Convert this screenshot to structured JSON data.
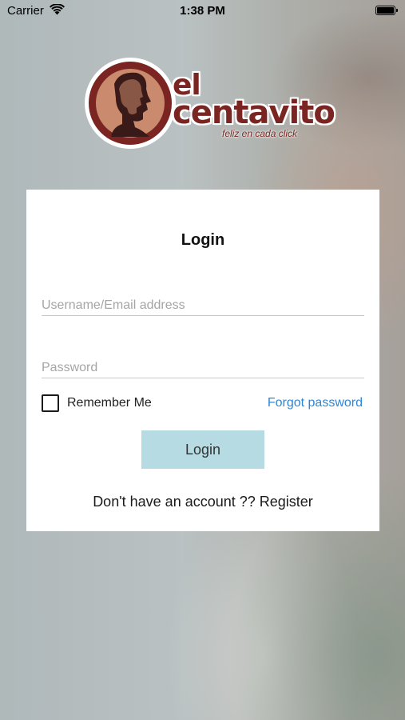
{
  "status_bar": {
    "carrier": "Carrier",
    "time": "1:38 PM",
    "battery_level": 1.0
  },
  "logo": {
    "word1": "el",
    "word2": "centavito",
    "tagline": "feliz en cada click",
    "brand_color": "#7a2522"
  },
  "login_form": {
    "title": "Login",
    "username_placeholder": "Username/Email address",
    "password_placeholder": "Password",
    "remember_label": "Remember Me",
    "remember_checked": false,
    "forgot_label": "Forgot password",
    "login_button": "Login",
    "register_text": "Don't have an account ?? Register"
  },
  "colors": {
    "link": "#2d86d6",
    "button_bg": "#b6dbe2"
  }
}
